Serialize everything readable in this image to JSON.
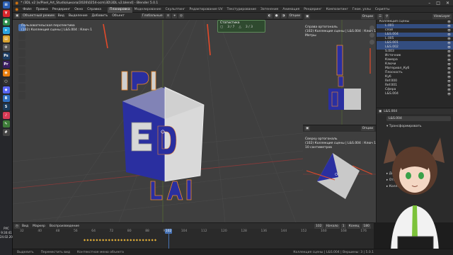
{
  "taskbar": {
    "icons": [
      {
        "name": "windows-start-icon",
        "glyph": "⊞",
        "color": "#2b5fb5"
      },
      {
        "name": "yandex-browser-icon",
        "glyph": "Y",
        "color": "#d8262c"
      },
      {
        "name": "chrome-icon",
        "glyph": "●",
        "color": "#2f8f4e"
      },
      {
        "name": "telegram-icon",
        "glyph": "➤",
        "color": "#2aa3e0"
      },
      {
        "name": "explorer-icon",
        "glyph": "▤",
        "color": "#d9a32f"
      },
      {
        "name": "settings-icon",
        "glyph": "⚙",
        "color": "#555555"
      },
      {
        "name": "photoshop-icon",
        "glyph": "Ps",
        "color": "#1c3c63"
      },
      {
        "name": "premiere-icon",
        "glyph": "Pr",
        "color": "#3b1f62"
      },
      {
        "name": "blender-icon",
        "glyph": "◉",
        "color": "#e87d0d"
      },
      {
        "name": "obs-icon",
        "glyph": "○",
        "color": "#303030"
      },
      {
        "name": "discord-icon",
        "glyph": "◆",
        "color": "#5865f2"
      },
      {
        "name": "vk-icon",
        "glyph": "B",
        "color": "#2f6fbf"
      },
      {
        "name": "steam-icon",
        "glyph": "S",
        "color": "#1b3b5a"
      },
      {
        "name": "music-icon",
        "glyph": "♪",
        "color": "#d83a55"
      },
      {
        "name": "notes-icon",
        "glyph": "✎",
        "color": "#3f7d3a"
      },
      {
        "name": "calc-icon",
        "glyph": "#",
        "color": "#444444"
      }
    ],
    "lang": "РУС",
    "time": "9:30:41",
    "date": "24.02.2026"
  },
  "title": "* /3DL v2 [e/Pixel_Art_Studio/школа/2026\\0254-ocm\\3D\\3DL v2.blend] - Blender 5.0.1",
  "menu": [
    "Файл",
    "Правка",
    "Рендеринг",
    "Окно",
    "Справка"
  ],
  "workspaces": [
    "Планировка",
    "Моделирование",
    "Скульптинг",
    "Редактирование UV",
    "Текстурирование",
    "Затенение",
    "Анимация",
    "Рендеринг",
    "Композитинг",
    "Геом. узлы",
    "Скрипты"
  ],
  "active_workspace": "Планировка",
  "vp_header": {
    "mode": "Объектный режим",
    "view": "Вид",
    "select": "Выделение",
    "add": "Добавить",
    "object": "Объект",
    "transform": "Глобальные",
    "options": "Опции"
  },
  "vp_info": {
    "line1": "Пользовательская перспектива",
    "line2": "(102) Коллекция сцены | L&S.004 : Ключ 1"
  },
  "stats": {
    "title": "Статистика",
    "objects": "3 / 7",
    "vertices": "3 / 3"
  },
  "right_top": {
    "line1": "Справа ортогональ",
    "line2": "(102) Коллекция сцены | L&S.004 : Ключ 1",
    "line3": "Метры",
    "options": "Опции"
  },
  "right_bot": {
    "line1": "Сверху ортогональ",
    "line2": "(102) Коллекция сцены | L&S.004 : Ключ 1",
    "line3": "10 сантиметров",
    "options": "Опции"
  },
  "outliner": {
    "view_layer": "ViewLayer",
    "rows": [
      {
        "label": "Коллекция сцены",
        "sel": false
      },
      {
        "label": "L.001",
        "sel": true
      },
      {
        "label": "слой",
        "sel": false
      },
      {
        "label": "L&S.004",
        "sel": true
      },
      {
        "label": "L.005",
        "sel": false
      },
      {
        "label": "L&S.001",
        "sel": true
      },
      {
        "label": "L&S.002",
        "sel": true
      },
      {
        "label": "S.003",
        "sel": false
      },
      {
        "label": "Источник",
        "sel": false
      },
      {
        "label": "Камера",
        "sel": false
      },
      {
        "label": "Ключи",
        "sel": false
      },
      {
        "label": "Материал_Куб",
        "sel": false
      },
      {
        "label": "Плоскость",
        "sel": false
      },
      {
        "label": "Куб",
        "sel": false
      },
      {
        "label": "Ref.000",
        "sel": false
      },
      {
        "label": "Ref.001",
        "sel": false
      },
      {
        "label": "Сфера",
        "sel": false
      },
      {
        "label": "L&S.004",
        "sel": false
      }
    ]
  },
  "props": {
    "object": "L&S.004",
    "name_field": "L&S.004",
    "section1": "Трансформировать",
    "section2": "Дельта-трансформация",
    "section3": "Отношения",
    "section4": "Коллекции"
  },
  "timeline": {
    "playback": "Воспроизведение",
    "view": "Вид",
    "marker": "Маркер",
    "current": "102",
    "start_label": "Начало",
    "start": "1",
    "end_label": "Конец",
    "end": "180",
    "ticks": [
      "32",
      "40",
      "48",
      "56",
      "64",
      "72",
      "80",
      "88",
      "96",
      "104",
      "112",
      "120",
      "128",
      "136",
      "144",
      "152",
      "160",
      "168",
      "176"
    ]
  },
  "status": {
    "left": "Выделить",
    "center": "Переместить вид",
    "right": "Контекстное меню объекта",
    "info": "Коллекция сцены | L&S.004 | Вершины: 3 | 5.0.1"
  },
  "colors": {
    "accent": "#4772b3",
    "selection": "#f28a2c",
    "cube_blue": "#2a2fa0",
    "cube_white": "#e9e9e9"
  }
}
